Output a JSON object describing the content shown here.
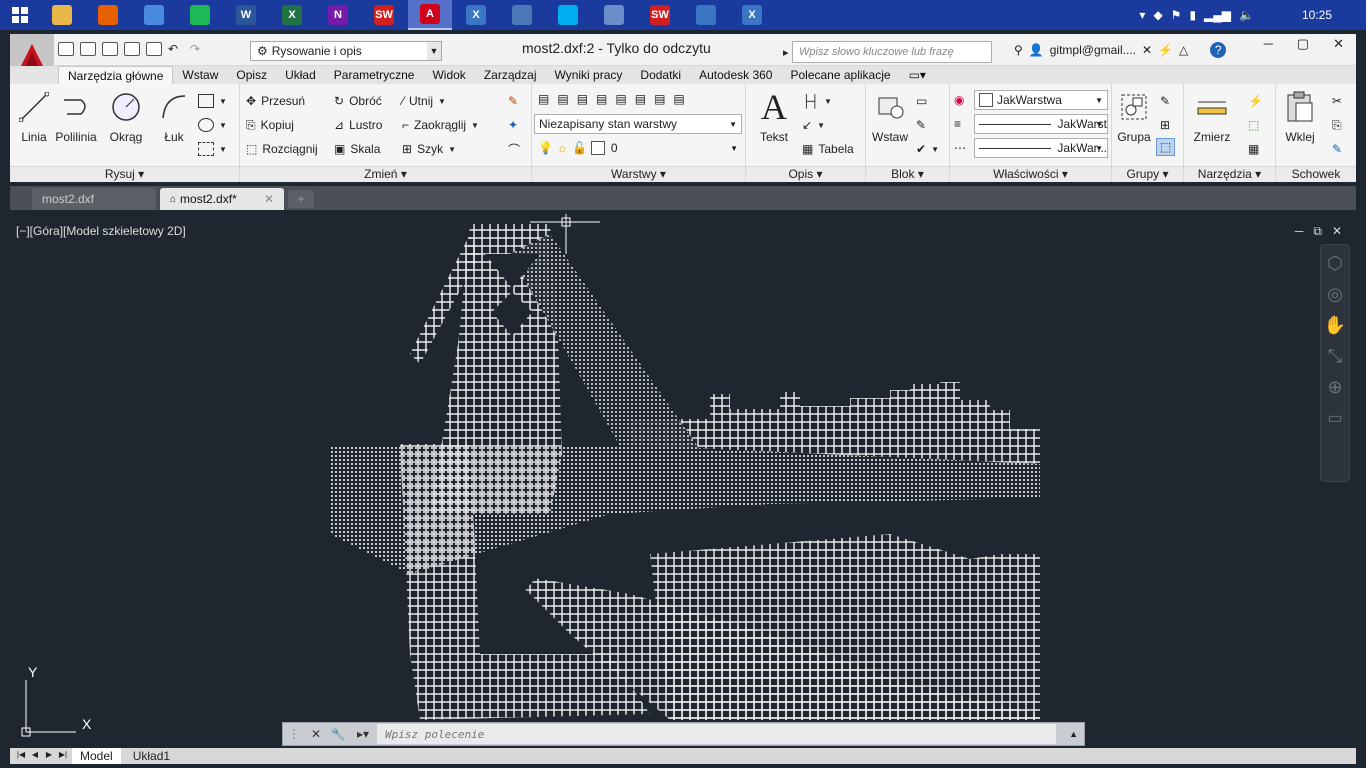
{
  "taskbar": {
    "apps": [
      {
        "name": "explorer",
        "color": "#e8b84a"
      },
      {
        "name": "firefox",
        "color": "#e66000"
      },
      {
        "name": "chromium",
        "color": "#4a8be0"
      },
      {
        "name": "spotify",
        "color": "#1db954"
      },
      {
        "name": "word",
        "color": "#2b579a",
        "label": "W"
      },
      {
        "name": "excel",
        "color": "#217346",
        "label": "X"
      },
      {
        "name": "onenote",
        "color": "#7719aa",
        "label": "N"
      },
      {
        "name": "solidworks",
        "color": "#d22020",
        "label": "SW"
      },
      {
        "name": "autocad",
        "color": "#d0021b",
        "label": "A"
      },
      {
        "name": "app-x1",
        "color": "#3b76c4",
        "label": "X"
      },
      {
        "name": "notes",
        "color": "#4a78b5"
      },
      {
        "name": "skype",
        "color": "#00aff0"
      },
      {
        "name": "book",
        "color": "#6a8fc8"
      },
      {
        "name": "solidworks2",
        "color": "#d22020",
        "label": "SW"
      },
      {
        "name": "remote",
        "color": "#3a76c4"
      },
      {
        "name": "app-x2",
        "color": "#3b76c4",
        "label": "X"
      }
    ],
    "clock": "10:25"
  },
  "app": {
    "workspace": "Rysowanie i opis",
    "title": "most2.dxf:2 - Tylko do odczytu",
    "search_placeholder": "Wpisz słowo kluczowe lub frazę",
    "user": "gitmpl@gmail...."
  },
  "ribbon_tabs": [
    "Narzędzia główne",
    "Wstaw",
    "Opisz",
    "Układ",
    "Parametryczne",
    "Widok",
    "Zarządzaj",
    "Wyniki pracy",
    "Dodatki",
    "Autodesk 360",
    "Polecane aplikacje"
  ],
  "draw": {
    "title": "Rysuj",
    "tools": [
      "Linia",
      "Polilinia",
      "Okrąg",
      "Łuk"
    ]
  },
  "modify": {
    "title": "Zmień",
    "col1": [
      "Przesuń",
      "Kopiuj",
      "Rozciągnij"
    ],
    "col2": [
      "Obróć",
      "Lustro",
      "Skala"
    ],
    "col3": [
      "Utnij",
      "Zaokrąglij",
      "Szyk"
    ]
  },
  "layers": {
    "title": "Warstwy",
    "state": "Niezapisany stan warstwy",
    "current": "0"
  },
  "annotation": {
    "title": "Opis",
    "text": "Tekst",
    "table": "Tabela"
  },
  "block": {
    "title": "Blok",
    "insert": "Wstaw"
  },
  "properties": {
    "title": "Właściwości",
    "color": "JakWarstwa",
    "linetype": "JakWarst",
    "lineweight": "JakWar..."
  },
  "groups": {
    "title": "Grupy",
    "group": "Grupa"
  },
  "utilities": {
    "title": "Narzędzia",
    "measure": "Zmierz"
  },
  "clipboard": {
    "title": "Schowek",
    "paste": "Wklej"
  },
  "files": {
    "tabs": [
      "most2.dxf",
      "most2.dxf*"
    ]
  },
  "viewport": {
    "label": "[−][Góra][Model szkieletowy 2D]",
    "axis_y": "Y",
    "axis_x": "X"
  },
  "command": {
    "placeholder": "Wpisz polecenie"
  },
  "layout_tabs": [
    "Model",
    "Układ1"
  ]
}
